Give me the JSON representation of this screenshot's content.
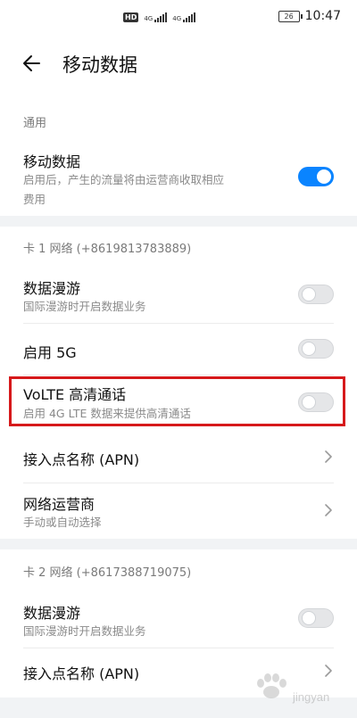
{
  "status": {
    "hd": "HD",
    "sim1_tech": "4G",
    "sim2_tech": "4G",
    "battery": "26",
    "time": "10:47"
  },
  "header": {
    "title": "移动数据"
  },
  "general": {
    "section_label": "通用",
    "mobile_data": {
      "title": "移动数据",
      "subtitle_line1": "启用后，产生的流量将由运营商收取相应",
      "subtitle_line2": "费用",
      "enabled": true
    }
  },
  "card1": {
    "section_label": "卡 1 网络 (+8619813783889)",
    "roaming": {
      "title": "数据漫游",
      "subtitle": "国际漫游时开启数据业务",
      "enabled": false
    },
    "enable_5g": {
      "title": "启用 5G",
      "enabled": false
    },
    "volte": {
      "title": "VoLTE 高清通话",
      "subtitle": "启用 4G LTE 数据来提供高清通话",
      "enabled": false
    },
    "apn": {
      "title": "接入点名称 (APN)"
    },
    "carrier": {
      "title": "网络运营商",
      "subtitle": "手动或自动选择"
    }
  },
  "card2": {
    "section_label": "卡 2 网络 (+8617388719075)",
    "roaming": {
      "title": "数据漫游",
      "subtitle": "国际漫游时开启数据业务",
      "enabled": false
    },
    "apn": {
      "title": "接入点名称 (APN)"
    }
  },
  "watermark": {
    "text": "jingyan"
  },
  "colors": {
    "accent": "#0a84ff",
    "highlight": "#d6191b",
    "section_gap": "#f1f3f5"
  }
}
